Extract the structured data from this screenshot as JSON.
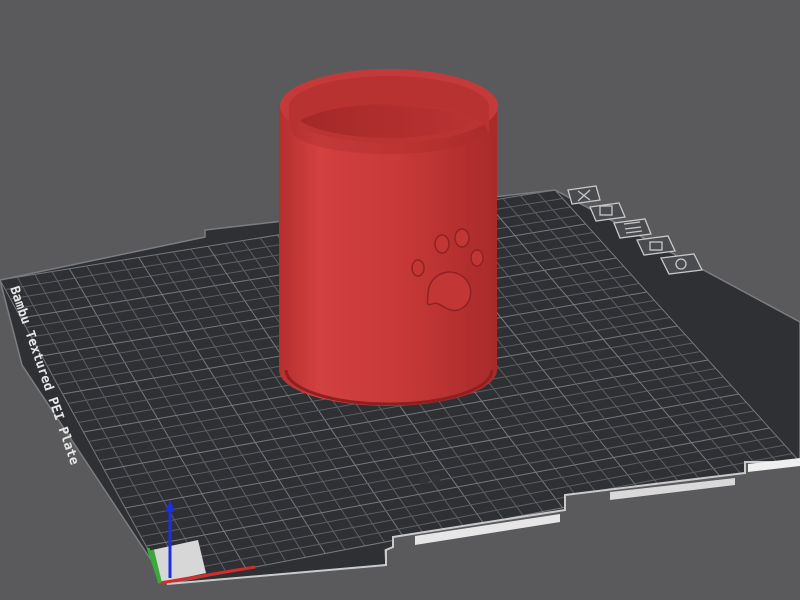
{
  "viewport": {
    "background_color": "#5a5a5c",
    "plate": {
      "label": "Bambu Textured PEI Plate",
      "base_color": "#2f3034",
      "grid_color": "#5a5c61",
      "edge_color": "#8a8c90",
      "plate_icons": [
        "close-icon",
        "auto-orient-icon",
        "arrange-icon",
        "lock-icon",
        "plate-settings-icon"
      ]
    },
    "model": {
      "shape": "cylinder-cup",
      "color": "#cc3b3b",
      "emboss": "paw-print"
    },
    "axes": {
      "x_color": "#d42b2b",
      "y_color": "#3aa93a",
      "z_color": "#1c2fd9"
    }
  }
}
